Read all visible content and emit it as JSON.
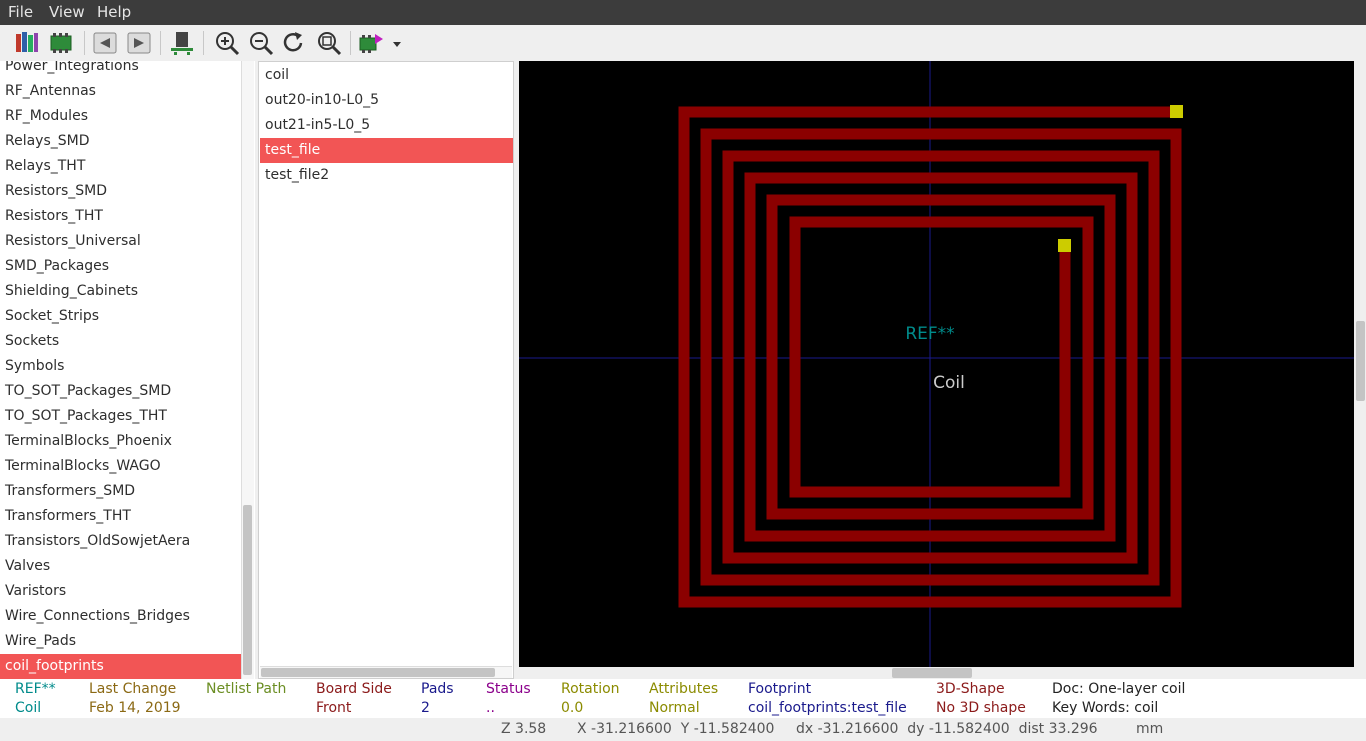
{
  "menu": {
    "file": "File",
    "view": "View",
    "help": "Help"
  },
  "toolbar": {
    "icons": [
      "library-icon",
      "footprint-board-icon",
      "previous-arrow-icon",
      "next-arrow-icon",
      "footprint-preview-icon",
      "zoom-in-icon",
      "zoom-out-icon",
      "redraw-icon",
      "zoom-fit-icon",
      "insert-footprint-icon",
      "dropdown-arrow-icon"
    ]
  },
  "libraries": [
    "Power_Integrations",
    "RF_Antennas",
    "RF_Modules",
    "Relays_SMD",
    "Relays_THT",
    "Resistors_SMD",
    "Resistors_THT",
    "Resistors_Universal",
    "SMD_Packages",
    "Shielding_Cabinets",
    "Socket_Strips",
    "Sockets",
    "Symbols",
    "TO_SOT_Packages_SMD",
    "TO_SOT_Packages_THT",
    "TerminalBlocks_Phoenix",
    "TerminalBlocks_WAGO",
    "Transformers_SMD",
    "Transformers_THT",
    "Transistors_OldSowjetAera",
    "Valves",
    "Varistors",
    "Wire_Connections_Bridges",
    "Wire_Pads",
    "coil_footprints"
  ],
  "selected_library": "coil_footprints",
  "footprints": [
    "coil",
    "out20-in10-L0_5",
    "out21-in5-L0_5",
    "test_file",
    "test_file2"
  ],
  "selected_footprint": "test_file",
  "canvas": {
    "reference_text": "REF**",
    "value_text": "Coil",
    "colors": {
      "background": "#000000",
      "track": "#8b0000",
      "pad": "#cccc00",
      "axis": "#1a1a8c",
      "reference": "#008b8b",
      "value": "#cccccc"
    }
  },
  "msg_panel": {
    "ref_label": "REF**",
    "ref_value": "Coil",
    "last_change_label": "Last Change",
    "last_change_value": "Feb 14, 2019",
    "netlist_path_label": "Netlist Path",
    "netlist_path_value": "",
    "board_side_label": "Board Side",
    "board_side_value": "Front",
    "pads_label": "Pads",
    "pads_value": "2",
    "status_label": "Status",
    "status_value": "..",
    "rotation_label": "Rotation",
    "rotation_value": "0.0",
    "attributes_label": "Attributes",
    "attributes_value": "Normal",
    "footprint_label": "Footprint",
    "footprint_value": "coil_footprints:test_file",
    "shape3d_label": "3D-Shape",
    "shape3d_value": "No 3D shape",
    "doc_label": "Doc: One-layer coil",
    "keywords_label": "Key Words: coil"
  },
  "status_bar": {
    "zoom": "Z 3.58",
    "xy": "X -31.216600  Y -11.582400",
    "dxdy": "dx -31.216600  dy -11.582400  dist 33.296",
    "units": "mm"
  }
}
